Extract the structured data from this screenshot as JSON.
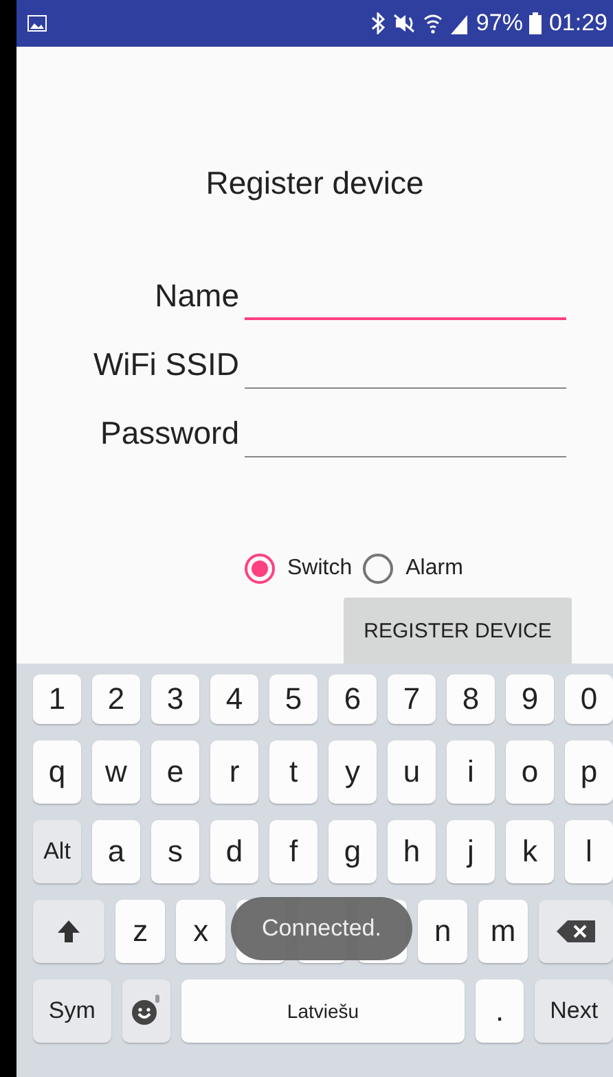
{
  "status_bar": {
    "battery": "97%",
    "time": "01:29"
  },
  "title": "Register device",
  "fields": [
    {
      "label": "Name",
      "focused": true
    },
    {
      "label": "WiFi SSID",
      "focused": false
    },
    {
      "label": "Password",
      "focused": false
    }
  ],
  "device_types": [
    {
      "label": "Switch",
      "selected": true
    },
    {
      "label": "Alarm",
      "selected": false
    }
  ],
  "register_button": "REGISTER DEVICE",
  "keyboard": {
    "rows": [
      [
        {
          "kind": "char",
          "label": "1"
        },
        {
          "kind": "char",
          "label": "2"
        },
        {
          "kind": "char",
          "label": "3"
        },
        {
          "kind": "char",
          "label": "4"
        },
        {
          "kind": "char",
          "label": "5"
        },
        {
          "kind": "char",
          "label": "6"
        },
        {
          "kind": "char",
          "label": "7"
        },
        {
          "kind": "char",
          "label": "8"
        },
        {
          "kind": "char",
          "label": "9"
        },
        {
          "kind": "char",
          "label": "0"
        }
      ],
      [
        {
          "kind": "char",
          "label": "q"
        },
        {
          "kind": "char",
          "label": "w"
        },
        {
          "kind": "char",
          "label": "e"
        },
        {
          "kind": "char",
          "label": "r"
        },
        {
          "kind": "char",
          "label": "t"
        },
        {
          "kind": "char",
          "label": "y"
        },
        {
          "kind": "char",
          "label": "u"
        },
        {
          "kind": "char",
          "label": "i"
        },
        {
          "kind": "char",
          "label": "o"
        },
        {
          "kind": "char",
          "label": "p"
        }
      ],
      [
        {
          "kind": "mod",
          "label": "Alt"
        },
        {
          "kind": "char",
          "label": "a"
        },
        {
          "kind": "char",
          "label": "s"
        },
        {
          "kind": "char",
          "label": "d"
        },
        {
          "kind": "char",
          "label": "f"
        },
        {
          "kind": "char",
          "label": "g"
        },
        {
          "kind": "char",
          "label": "h"
        },
        {
          "kind": "char",
          "label": "j"
        },
        {
          "kind": "char",
          "label": "k"
        },
        {
          "kind": "char",
          "label": "l"
        }
      ],
      [
        {
          "kind": "shift"
        },
        {
          "kind": "char",
          "label": "z"
        },
        {
          "kind": "char",
          "label": "x"
        },
        {
          "kind": "blank"
        },
        {
          "kind": "blank"
        },
        {
          "kind": "blank"
        },
        {
          "kind": "char",
          "label": "n"
        },
        {
          "kind": "char",
          "label": "m"
        },
        {
          "kind": "backspace"
        }
      ]
    ],
    "bottom_row": [
      {
        "kind": "action",
        "label": "Sym"
      },
      {
        "kind": "emoji"
      },
      {
        "kind": "space",
        "label": "Latviešu"
      },
      {
        "kind": "char",
        "label": "."
      },
      {
        "kind": "action",
        "label": "Next"
      }
    ]
  },
  "toast": "Connected."
}
